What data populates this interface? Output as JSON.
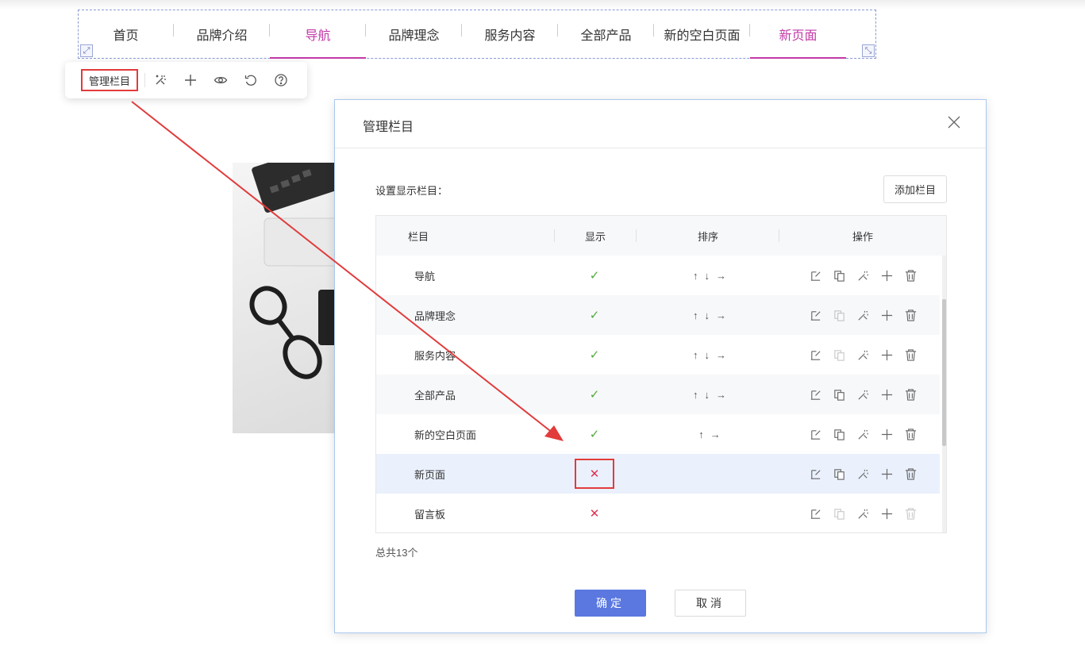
{
  "nav": {
    "items": [
      {
        "label": "首页",
        "active": false
      },
      {
        "label": "品牌介绍",
        "active": false
      },
      {
        "label": "导航",
        "active": true
      },
      {
        "label": "品牌理念",
        "active": false
      },
      {
        "label": "服务内容",
        "active": false
      },
      {
        "label": "全部产品",
        "active": false
      },
      {
        "label": "新的空白页面",
        "active": false
      },
      {
        "label": "新页面",
        "active": true
      }
    ]
  },
  "toolbar": {
    "manage_label": "管理栏目",
    "icons": [
      "magic-wand-icon",
      "plus-icon",
      "eye-icon",
      "undo-icon",
      "help-icon"
    ]
  },
  "dialog": {
    "title": "管理栏目",
    "settings_label": "设置显示栏目：",
    "add_button": "添加栏目",
    "columns": {
      "name": "栏目",
      "show": "显示",
      "sort": "排序",
      "ops": "操作"
    },
    "rows": [
      {
        "name": "导航",
        "show": true,
        "sort": [
          "↑",
          "↓",
          "→"
        ]
      },
      {
        "name": "品牌理念",
        "show": true,
        "sort": [
          "↑",
          "↓",
          "→"
        ]
      },
      {
        "name": "服务内容",
        "show": true,
        "sort": [
          "↑",
          "↓",
          "→"
        ]
      },
      {
        "name": "全部产品",
        "show": true,
        "sort": [
          "↑",
          "↓",
          "→"
        ]
      },
      {
        "name": "新的空白页面",
        "show": true,
        "sort": [
          "↑",
          "→"
        ]
      },
      {
        "name": "新页面",
        "show": false,
        "sort": []
      },
      {
        "name": "留言板",
        "show": false,
        "sort": []
      }
    ],
    "total": "总共13个",
    "ok_button": "确定",
    "cancel_button": "取消"
  },
  "colors": {
    "accent": "#c23aa8",
    "primary": "#5b78e0",
    "annotation": "#e23b3b",
    "check": "#52a93c",
    "cross": "#e0314f"
  }
}
